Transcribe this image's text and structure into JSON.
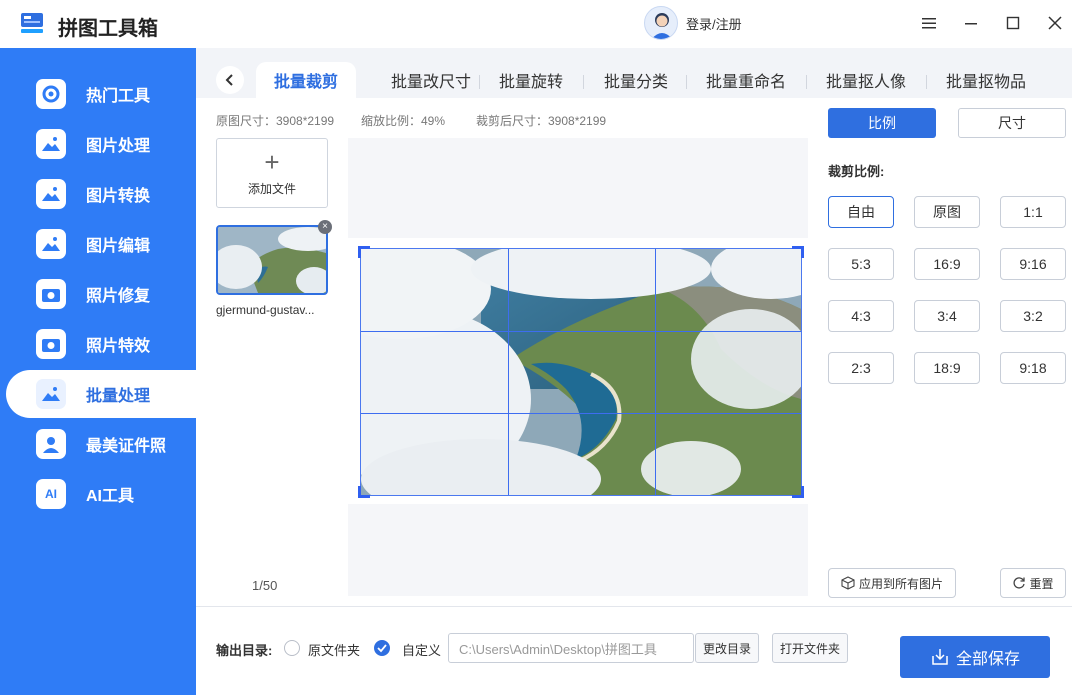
{
  "app": {
    "title": "拼图工具箱",
    "user_label": "登录/注册"
  },
  "sidebar": {
    "items": [
      {
        "label": "热门工具"
      },
      {
        "label": "图片处理"
      },
      {
        "label": "图片转换"
      },
      {
        "label": "图片编辑"
      },
      {
        "label": "照片修复"
      },
      {
        "label": "照片特效"
      },
      {
        "label": "批量处理",
        "active": true
      },
      {
        "label": "最美证件照"
      },
      {
        "label": "AI工具"
      }
    ]
  },
  "tabs": [
    {
      "label": "批量裁剪",
      "active": true
    },
    {
      "label": "批量改尺寸"
    },
    {
      "label": "批量旋转"
    },
    {
      "label": "批量分类"
    },
    {
      "label": "批量重命名"
    },
    {
      "label": "批量抠人像"
    },
    {
      "label": "批量抠物品"
    }
  ],
  "meta": {
    "original_size": "原图尺寸：3908*2199",
    "zoom": "缩放比例：49%",
    "cropped_size": "裁剪后尺寸：3908*2199"
  },
  "files": {
    "add_label": "添加文件",
    "items": [
      {
        "name": "gjermund-gustav..."
      }
    ],
    "pager": "1/50"
  },
  "settings": {
    "mode_ratio": "比例",
    "mode_size": "尺寸",
    "ratio_title": "裁剪比例:",
    "ratios": [
      "自由",
      "原图",
      "1:1",
      "5:3",
      "16:9",
      "9:16",
      "4:3",
      "3:4",
      "3:2",
      "2:3",
      "18:9",
      "9:18"
    ],
    "selected_ratio": "自由",
    "apply_all": "应用到所有图片",
    "reset": "重置"
  },
  "output": {
    "label": "输出目录:",
    "option_original": "原文件夹",
    "option_custom": "自定义",
    "selected": "自定义",
    "path": "C:\\Users\\Admin\\Desktop\\拼图工具",
    "change_dir": "更改目录",
    "open_folder": "打开文件夹",
    "save_all": "全部保存"
  }
}
